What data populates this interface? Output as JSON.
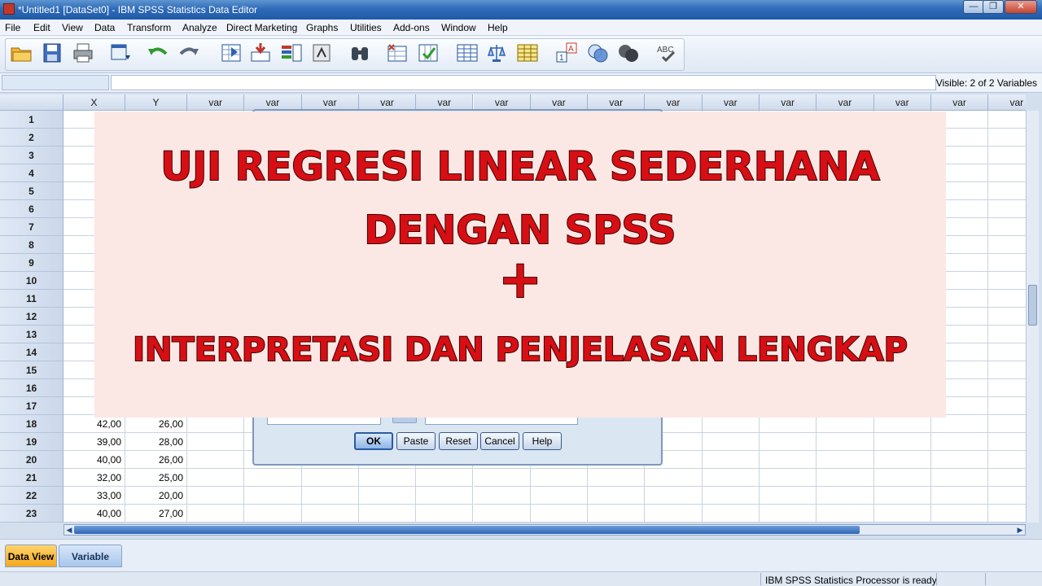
{
  "window": {
    "title": "*Untitled1 [DataSet0] - IBM SPSS Statistics Data Editor",
    "minimize": "0",
    "restore": "1",
    "close": "r"
  },
  "menu": [
    "File",
    "Edit",
    "View",
    "Data",
    "Transform",
    "Analyze",
    "Direct Marketing",
    "Graphs",
    "Utilities",
    "Add-ons",
    "Window",
    "Help"
  ],
  "toolbar": {
    "icons": [
      "open-folder-icon",
      "save-icon",
      "print-icon",
      "dialog-recall-icon",
      "undo-icon",
      "redo-icon",
      "go-to-case-icon",
      "go-to-variable-icon",
      "variables-icon",
      "run-descriptives-icon",
      "find-icon",
      "insert-cases-icon",
      "insert-variable-icon",
      "split-file-icon",
      "weight-cases-icon",
      "select-cases-icon",
      "value-labels-icon",
      "use-variable-sets-icon",
      "show-all-variables-icon",
      "spell-check-icon"
    ],
    "spellcheck_label": "ABC"
  },
  "editor": {
    "visible_label": "Visible: 2 of 2 Variables"
  },
  "grid": {
    "columns": [
      "X",
      "Y",
      "var",
      "var",
      "var",
      "var",
      "var",
      "var",
      "var",
      "var",
      "var",
      "var",
      "var",
      "var",
      "var",
      "var",
      "var"
    ],
    "rows": [
      {
        "num": "1",
        "x": "",
        "y": ""
      },
      {
        "num": "2",
        "x": "",
        "y": ""
      },
      {
        "num": "3",
        "x": "",
        "y": ""
      },
      {
        "num": "4",
        "x": "",
        "y": ""
      },
      {
        "num": "5",
        "x": "",
        "y": ""
      },
      {
        "num": "6",
        "x": "",
        "y": ""
      },
      {
        "num": "7",
        "x": "",
        "y": ""
      },
      {
        "num": "8",
        "x": "",
        "y": ""
      },
      {
        "num": "9",
        "x": "",
        "y": ""
      },
      {
        "num": "10",
        "x": "",
        "y": ""
      },
      {
        "num": "11",
        "x": "",
        "y": ""
      },
      {
        "num": "12",
        "x": "",
        "y": ""
      },
      {
        "num": "13",
        "x": "",
        "y": ""
      },
      {
        "num": "14",
        "x": "",
        "y": ""
      },
      {
        "num": "15",
        "x": "",
        "y": ""
      },
      {
        "num": "16",
        "x": "",
        "y": ""
      },
      {
        "num": "17",
        "x": "",
        "y": ""
      },
      {
        "num": "18",
        "x": "42,00",
        "y": "26,00"
      },
      {
        "num": "19",
        "x": "39,00",
        "y": "28,00"
      },
      {
        "num": "20",
        "x": "40,00",
        "y": "26,00"
      },
      {
        "num": "21",
        "x": "32,00",
        "y": "25,00"
      },
      {
        "num": "22",
        "x": "33,00",
        "y": "20,00"
      },
      {
        "num": "23",
        "x": "40,00",
        "y": "27,00"
      }
    ]
  },
  "dialog": {
    "buttons": [
      "OK",
      "Paste",
      "Reset",
      "Cancel",
      "Help"
    ]
  },
  "banner": {
    "line1": "UJI REGRESI LINEAR SEDERHANA",
    "line2": "DENGAN SPSS",
    "line3": "+",
    "line4": "INTERPRETASI DAN PENJELASAN LENGKAP",
    "text_color": "#d70f14",
    "background": "#fbe7e4"
  },
  "tabs": {
    "data_view": "Data View",
    "variable_view": "Variable View"
  },
  "status": {
    "processor": "IBM SPSS Statistics Processor is ready"
  }
}
